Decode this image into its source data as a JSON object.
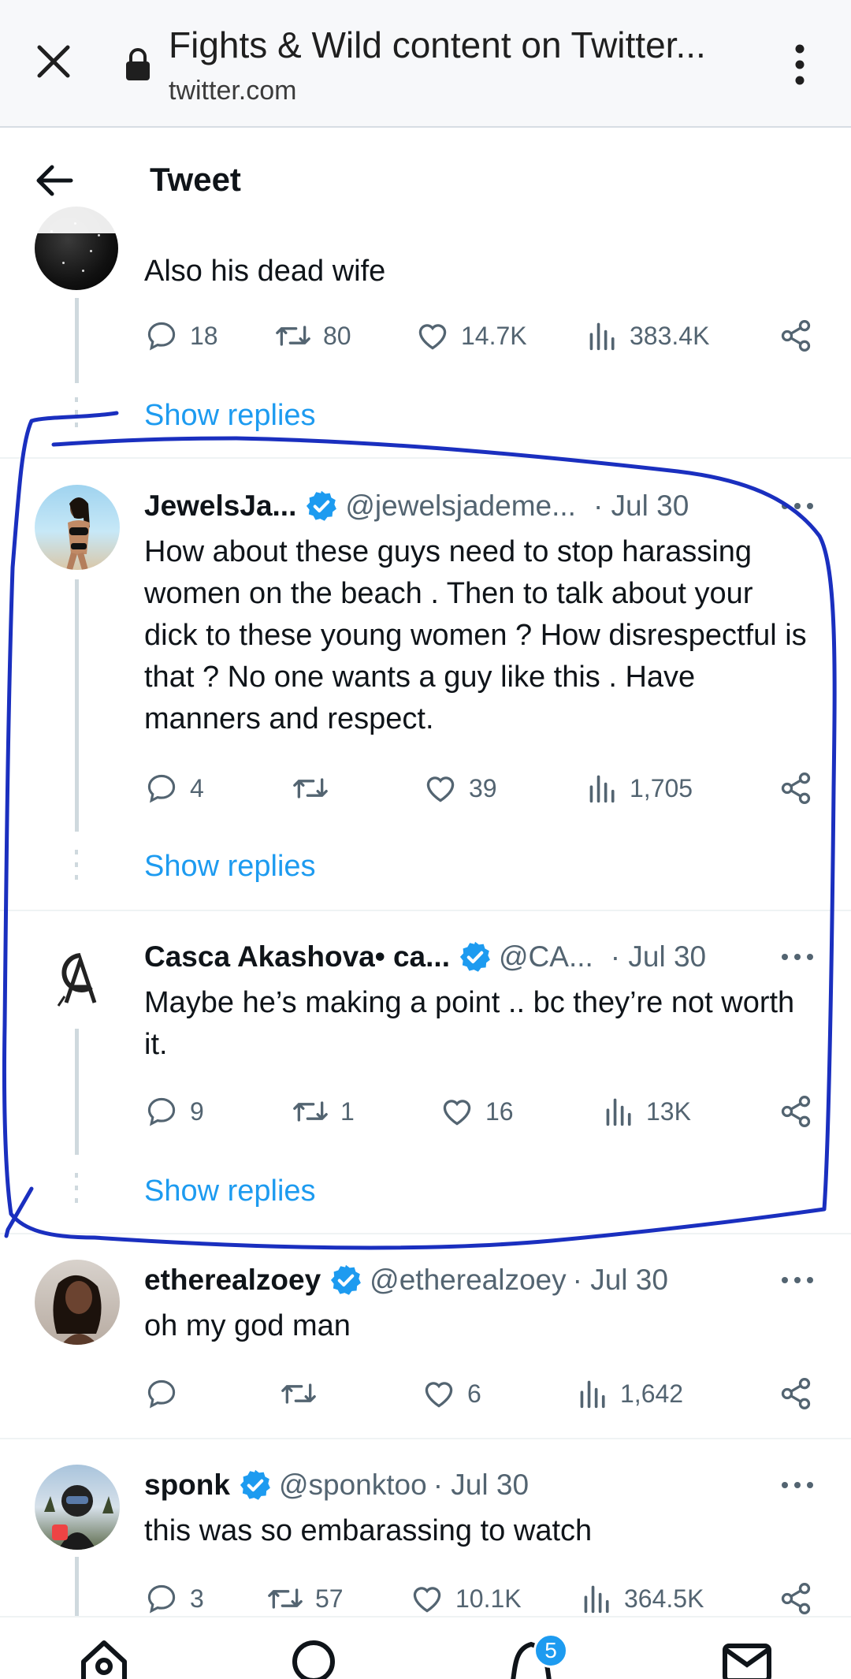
{
  "browser": {
    "title": "Fights & Wild content on Twitter...",
    "url": "twitter.com"
  },
  "header": {
    "title": "Tweet"
  },
  "peek_tweet": {
    "text": "Also his dead wife",
    "stats": {
      "replies": "18",
      "retweets": "80",
      "likes": "14.7K",
      "views": "383.4K"
    },
    "show_replies": "Show replies"
  },
  "tweets": [
    {
      "name": "JewelsJa...",
      "handle": "@jewelsjademe...",
      "date": "· Jul 30",
      "text": "How about these guys need to stop harassing women on the beach . Then to talk about your dick to these young women ? How disrespectful is that ? No one wants a guy like this . Have manners and respect.",
      "stats": {
        "replies": "4",
        "retweets": "",
        "likes": "39",
        "views": "1,705"
      },
      "show_replies": "Show replies"
    },
    {
      "name": "Casca Akashova• ca...",
      "handle": "@CA...",
      "date": "· Jul 30",
      "text": "Maybe he’s making a point .. bc they’re not worth it.",
      "stats": {
        "replies": "9",
        "retweets": "1",
        "likes": "16",
        "views": "13K"
      },
      "show_replies": "Show replies"
    },
    {
      "name": "etherealzoey",
      "handle": "@etherealzoey",
      "date": "· Jul 30",
      "text": "oh my god man",
      "stats": {
        "replies": "",
        "retweets": "",
        "likes": "6",
        "views": "1,642"
      }
    },
    {
      "name": "sponk",
      "handle": "@sponktoo",
      "date": "· Jul 30",
      "text": "this was so embarassing to watch",
      "stats": {
        "replies": "3",
        "retweets": "57",
        "likes": "10.1K",
        "views": "364.5K"
      }
    }
  ],
  "nav": {
    "notifications_badge": "5"
  },
  "colors": {
    "accent": "#1d9bf0",
    "annotation": "#1a2fbf",
    "muted": "#536471"
  },
  "icons": [
    "close-icon",
    "lock-icon",
    "more-vert-icon",
    "back-arrow-icon",
    "reply-icon",
    "retweet-icon",
    "like-icon",
    "views-icon",
    "share-icon",
    "verified-icon",
    "home-icon",
    "search-icon",
    "bell-icon",
    "mail-icon"
  ]
}
